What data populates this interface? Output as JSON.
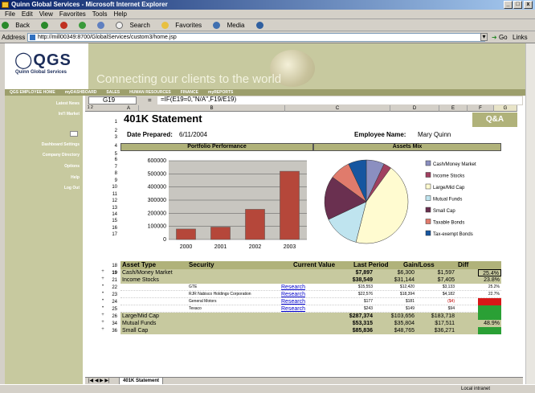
{
  "window": {
    "title": "Quinn Global Services - Microsoft Internet Explorer"
  },
  "menu": [
    "File",
    "Edit",
    "View",
    "Favorites",
    "Tools",
    "Help"
  ],
  "toolbar": {
    "back": "Back",
    "search": "Search",
    "favorites": "Favorites",
    "media": "Media"
  },
  "address": {
    "label": "Address",
    "url": "http://mill00349:8700/GlobalServices/custom3/home.jsp",
    "go": "Go",
    "links": "Links"
  },
  "banner": {
    "logo": "QGS",
    "logo_sub": "Quinn Global Services",
    "tagline": "Connecting our clients to the world"
  },
  "nav": [
    "QGS EMPLOYEE HOME",
    "myDASHBOARD",
    "SALES",
    "HUMAN RESOURCES",
    "FINANCE",
    "myREPORTS"
  ],
  "sidenav": [
    "Latest News",
    "Int'l Market",
    "Dashboard Settings",
    "Company Directory",
    "Options",
    "Help",
    "Log Out"
  ],
  "formula_bar": {
    "cell": "G19",
    "formula": "=IF(E19=0,\"N/A\",F19/E19)"
  },
  "columns": [
    "A",
    "B",
    "C",
    "D",
    "E",
    "F",
    "G"
  ],
  "rows": [
    "1",
    "2",
    "3",
    "4",
    "5",
    "6",
    "7",
    "8",
    "9",
    "10",
    "11",
    "12",
    "13",
    "14",
    "15",
    "16",
    "17",
    "18",
    "19",
    "21",
    "22",
    "23",
    "24",
    "25",
    "26",
    "34",
    "36"
  ],
  "sheet": {
    "title": "401K Statement",
    "qa": "Q&A",
    "date_label": "Date Prepared:",
    "date_value": "6/11/2004",
    "emp_label": "Employee Name:",
    "emp_value": "Mary Quinn",
    "perf_title": "Portfolio Performance",
    "mix_title": "Assets Mix",
    "table_headers": [
      "Asset Type",
      "Security",
      "Current Value",
      "Last Period",
      "Gain/Loss",
      "Diff"
    ],
    "rows": [
      {
        "type": "Cash/Money Market",
        "security": "",
        "current": "$7,897",
        "last": "$6,300",
        "gain": "$1,597",
        "diff": "25.4%",
        "kind": "grp"
      },
      {
        "type": "Income Stocks",
        "security": "",
        "current": "$38,549",
        "last": "$31,144",
        "gain": "$7,405",
        "diff": "23.8%",
        "kind": "grp"
      },
      {
        "type": "",
        "security": "GTE",
        "link": "Research",
        "current": "$15,553",
        "last": "$12,420",
        "gain": "$3,133",
        "diff": "25.2%",
        "kind": "sub"
      },
      {
        "type": "",
        "security": "RJR Nabisco Holdings Corporation",
        "link": "Research",
        "current": "$22,576",
        "last": "$18,394",
        "gain": "$4,182",
        "diff": "22.7%",
        "kind": "sub"
      },
      {
        "type": "",
        "security": "General Motors",
        "link": "Research",
        "current": "$177",
        "last": "$181",
        "gain": "($4)",
        "diff": "",
        "kind": "sub"
      },
      {
        "type": "",
        "security": "Texaco",
        "link": "Research",
        "current": "$243",
        "last": "$149",
        "gain": "$94",
        "diff": "",
        "kind": "sub"
      },
      {
        "type": "Large/Mid Cap",
        "security": "",
        "current": "$287,374",
        "last": "$103,656",
        "gain": "$183,718",
        "diff": "",
        "kind": "grp"
      },
      {
        "type": "Mutual Funds",
        "security": "",
        "current": "$53,315",
        "last": "$35,804",
        "gain": "$17,511",
        "diff": "48.9%",
        "kind": "grp"
      },
      {
        "type": "Small Cap",
        "security": "",
        "current": "$85,836",
        "last": "$48,765",
        "gain": "$36,271",
        "diff": "",
        "kind": "grp"
      }
    ]
  },
  "sheet_tab": "401K Statement",
  "status": {
    "zone": "Local intranet"
  },
  "colors": {
    "olive": "#c7c99f",
    "olive_dark": "#9d9f6c",
    "bar": "#b5473a",
    "navy": "#1c2d5a"
  },
  "chart_data": [
    {
      "type": "bar",
      "title": "Portfolio Performance",
      "categories": [
        "2000",
        "2001",
        "2002",
        "2003"
      ],
      "values": [
        80000,
        95000,
        230000,
        520000
      ],
      "ylim": [
        0,
        600000
      ],
      "yticks": [
        "0",
        "100000",
        "200000",
        "300000",
        "400000",
        "500000",
        "600000"
      ],
      "grid": true
    },
    {
      "type": "pie",
      "title": "Assets Mix",
      "labels": [
        "Cash/Money Market",
        "Income Stocks",
        "Large/Mid Cap",
        "Mutual Funds",
        "Small Cap",
        "Taxable Bonds",
        "Tax-exempt Bonds"
      ],
      "values": [
        7,
        3,
        44,
        14,
        17,
        8,
        7
      ],
      "colors": [
        "#8b8fc0",
        "#a04060",
        "#fffbd0",
        "#bfe4ef",
        "#6a3050",
        "#e07b6c",
        "#1656a0"
      ],
      "legend": "right"
    }
  ]
}
